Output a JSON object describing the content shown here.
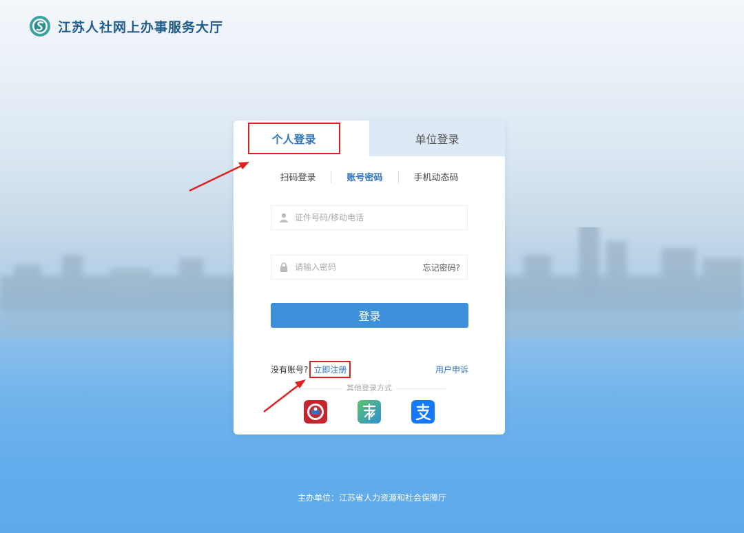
{
  "header": {
    "site_title": "江苏人社网上办事服务大厅",
    "logo_icon": "jiangsu-hrss-logo-icon"
  },
  "login_card": {
    "tabs": [
      {
        "label": "个人登录"
      },
      {
        "label": "单位登录"
      }
    ],
    "methods": [
      {
        "label": "扫码登录"
      },
      {
        "label": "账号密码"
      },
      {
        "label": "手机动态码"
      }
    ],
    "id_field": {
      "placeholder": "证件号码/移动电话",
      "icon": "user-icon"
    },
    "password_field": {
      "placeholder": "请输入密码",
      "icon": "lock-icon"
    },
    "forgot_password": "忘记密码?",
    "login_button": "登录",
    "no_account": "没有账号?",
    "register": "立即注册",
    "user_appeal": "用户申诉",
    "other_methods": "其他登录方式",
    "other_apps": [
      "ecard-app-icon",
      "su-app-icon",
      "alipay-icon"
    ]
  },
  "footer": {
    "organizer": "主办单位：江苏省人力资源和社会保障厅"
  },
  "colors": {
    "accent": "#2f74bd",
    "button": "#3d8fda",
    "highlight": "#e02020"
  }
}
